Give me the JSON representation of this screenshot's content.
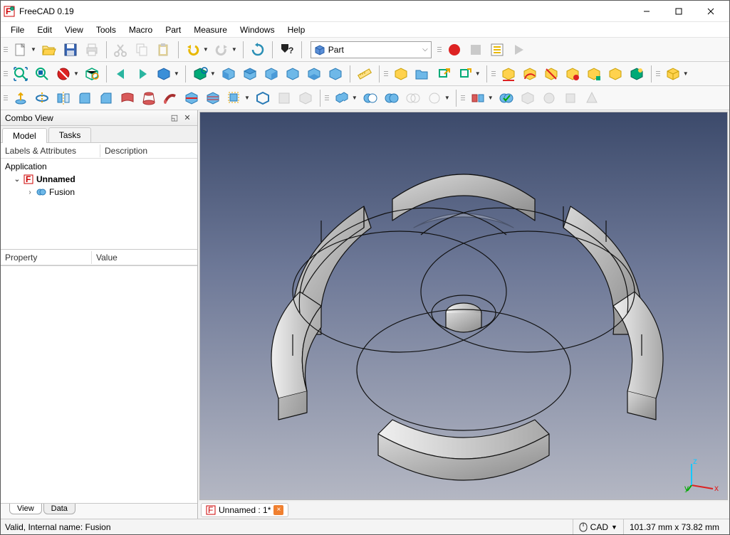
{
  "window": {
    "title": "FreeCAD 0.19"
  },
  "menus": [
    "File",
    "Edit",
    "View",
    "Tools",
    "Macro",
    "Part",
    "Measure",
    "Windows",
    "Help"
  ],
  "workbench": {
    "selected": "Part"
  },
  "combo": {
    "title": "Combo View",
    "tabs": {
      "model": "Model",
      "tasks": "Tasks"
    },
    "tree_headers": {
      "labels": "Labels & Attributes",
      "desc": "Description"
    },
    "tree": {
      "application": "Application",
      "doc": "Unnamed",
      "item": "Fusion"
    },
    "prop_headers": {
      "property": "Property",
      "value": "Value"
    },
    "bottom_tabs": {
      "view": "View",
      "data": "Data"
    }
  },
  "doc_tab": {
    "label": "Unnamed : 1*"
  },
  "status": {
    "left": "Valid, Internal name: Fusion",
    "nav": "CAD",
    "dims": "101.37 mm x 73.82 mm"
  }
}
